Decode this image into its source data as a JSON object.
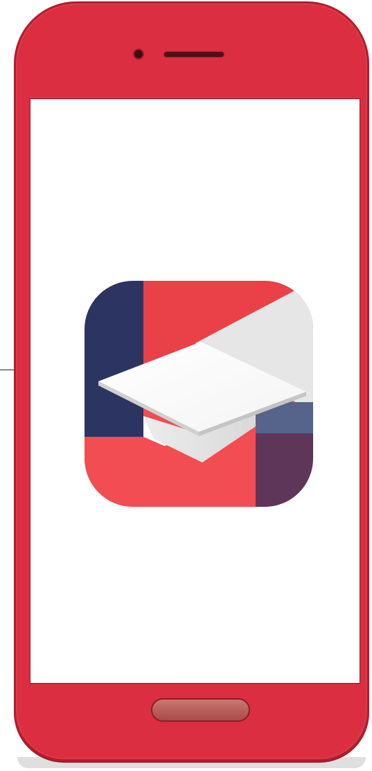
{
  "device": {
    "frame_color": "#db2e40",
    "screen_color": "#ffffff"
  },
  "app_icon": {
    "icon_name": "graduation-cap-app-icon",
    "colors": {
      "navy": "#2c3561",
      "red": "#f24d52",
      "light_gray": "#e6e6e6",
      "white": "#ffffff",
      "slate_blue": "#56638b",
      "plum": "#5d3659"
    }
  },
  "home_button": {
    "icon_name": "home-button"
  }
}
